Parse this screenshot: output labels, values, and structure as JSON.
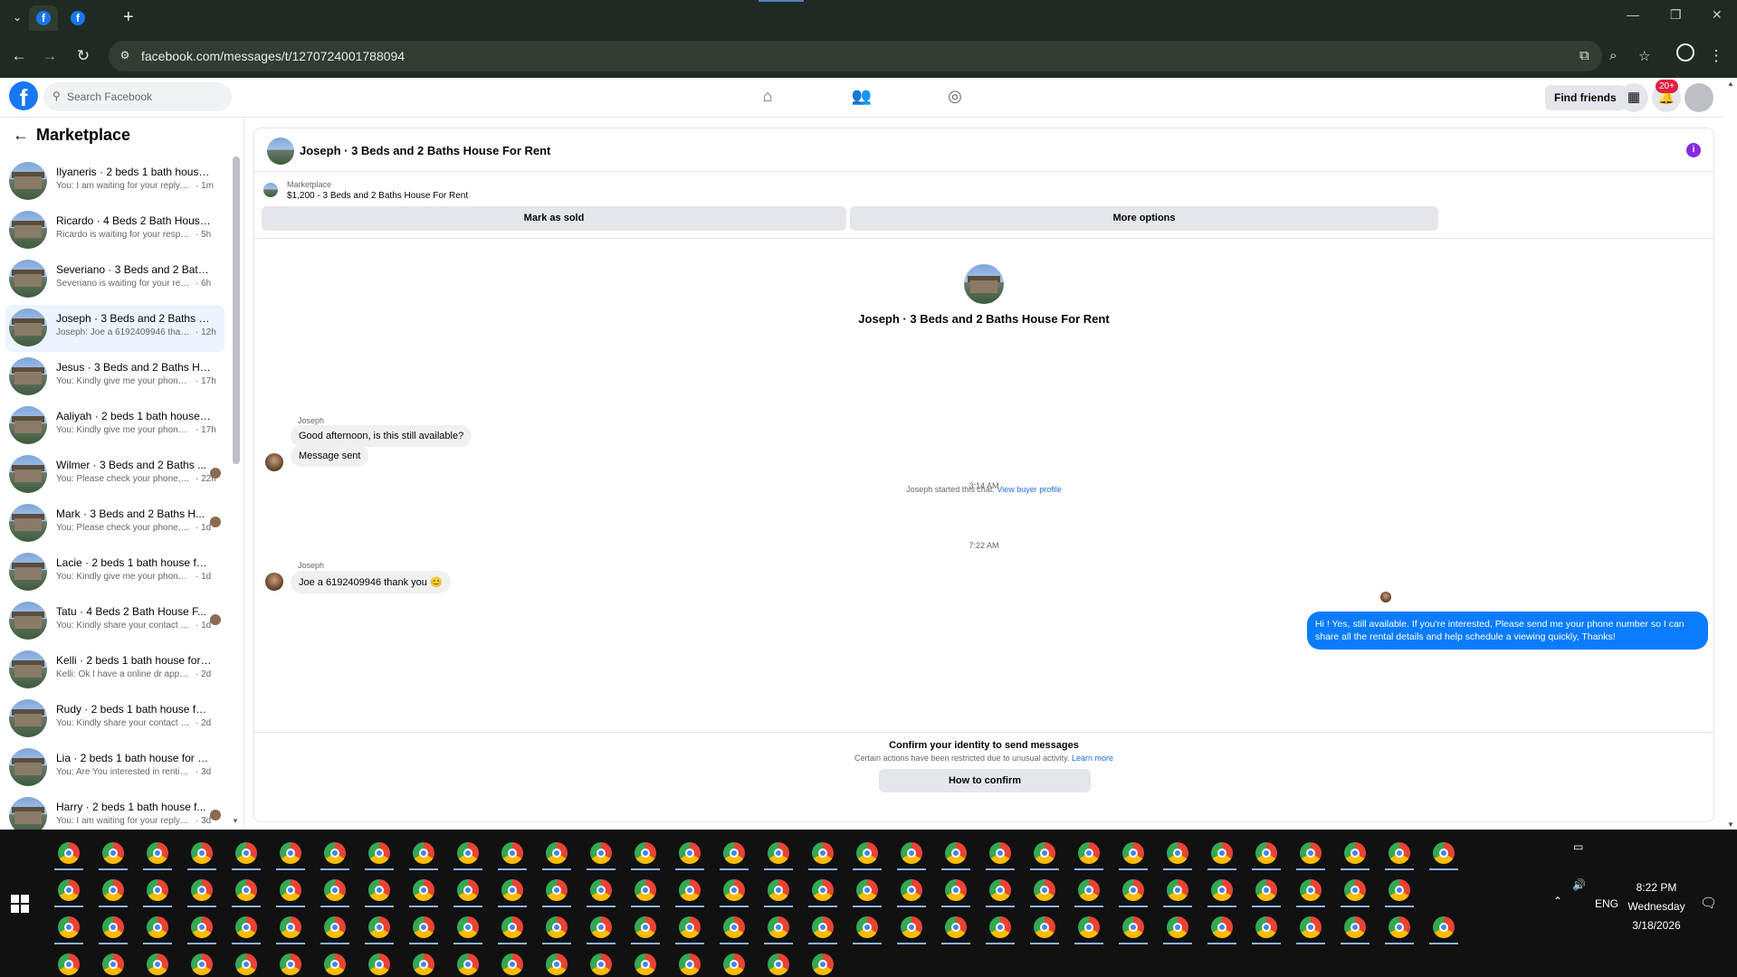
{
  "browser": {
    "url": "facebook.com/messages/t/1270724001788094",
    "tabs": [
      {
        "favicon": "facebook-icon"
      },
      {
        "favicon": "facebook-icon"
      }
    ]
  },
  "header": {
    "search_placeholder": "Search Facebook",
    "find_friends": "Find friends",
    "notifications_badge": "20+"
  },
  "sidebar": {
    "title": "Marketplace",
    "conversations": [
      {
        "name": "Ilyaneris · 2 beds 1 bath house f...",
        "last": "You: I am waiting for your reply, p...",
        "time": "· 1m"
      },
      {
        "name": "Ricardo · 4 Beds 2 Bath House F...",
        "last": "Ricardo is waiting for your respon...",
        "time": "· 5h"
      },
      {
        "name": "Severiano · 3 Beds and 2 Baths ...",
        "last": "Severiano is waiting for your resp...",
        "time": "· 6h"
      },
      {
        "name": "Joseph · 3 Beds and 2 Baths Ho...",
        "last": "Joseph: Joe a 6192409946 thank ...",
        "time": "· 12h"
      },
      {
        "name": "Jesus · 3 Beds and 2 Baths Hous...",
        "last": "You: Kindly give me your phone ...",
        "time": "· 17h"
      },
      {
        "name": "Aaliyah · 2 beds 1 bath house fo...",
        "last": "You: Kindly give me your phone ...",
        "time": "· 17h"
      },
      {
        "name": "Wilmer · 3 Beds and 2 Baths ...",
        "last": "You: Please check your phone, ...",
        "time": "· 22h"
      },
      {
        "name": "Mark · 3 Beds and 2 Baths H...",
        "last": "You: Please check your phone, I...",
        "time": "· 1d"
      },
      {
        "name": "Lacie · 2 beds 1 bath house for r...",
        "last": "You: Kindly give me your phone n...",
        "time": "· 1d"
      },
      {
        "name": "Tatu · 4 Beds 2 Bath House F...",
        "last": "You: Kindly share your contact ...",
        "time": "· 1d"
      },
      {
        "name": "Kelli · 2 beds 1 bath house for r...",
        "last": "Kelli: Ok I have a online dr appoint...",
        "time": "· 2d"
      },
      {
        "name": "Rudy · 2 beds 1 bath house for r...",
        "last": "You: Kindly share your contact nu...",
        "time": "· 2d"
      },
      {
        "name": "Lia · 2 beds 1 bath house for rent",
        "last": "You: Are You interested in renting ...",
        "time": "· 3d"
      },
      {
        "name": "Harry · 2 beds 1 bath house f...",
        "last": "You: I am waiting for your reply, ...",
        "time": "· 3d"
      }
    ]
  },
  "chat": {
    "title": "Joseph · 3 Beds and 2 Baths House For Rent",
    "marketplace_label": "Marketplace",
    "listing": "$1,200 - 3 Beds and 2 Baths House For Rent",
    "mark_sold": "Mark as sold",
    "more_options": "More options",
    "thread_title": "Joseph · 3 Beds and 2 Baths House For Rent",
    "started_text": "Joseph started this chat.",
    "view_profile": "View buyer profile",
    "sender": "Joseph",
    "msg1": "Good afternoon, is this still available?",
    "msg2": "Message sent",
    "time1": "3:14 AM",
    "out_msg": "Hi ! Yes, still available. If you're interested, Please send me your phone number so I can share all the rental details and help schedule a viewing quickly, Thanks!",
    "time2": "7:22 AM",
    "sender2": "Joseph",
    "msg3": "Joe a 6192409946 thank you 😊",
    "confirm_title": "Confirm your identity to send messages",
    "confirm_desc": "Certain actions have been restricted due to unusual activity.",
    "learn_more": "Learn more",
    "how_to_confirm": "How to confirm"
  },
  "taskbar": {
    "language": "ENG",
    "time": "8:22 PM",
    "day": "Wednesday",
    "date": "3/18/2026"
  }
}
